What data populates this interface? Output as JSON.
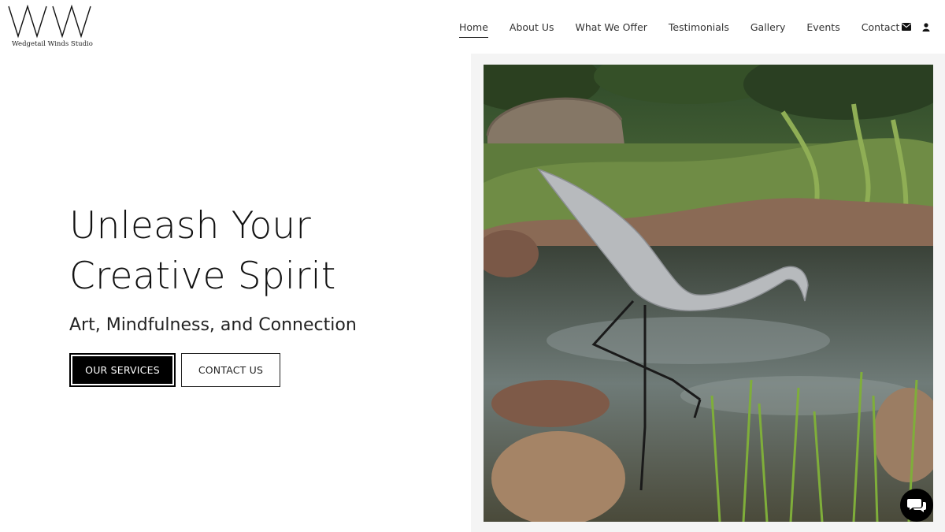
{
  "brand": {
    "logo_letters": "WW",
    "name": "Wedgetail Winds Studio"
  },
  "nav": {
    "items": [
      {
        "label": "Home",
        "active": true
      },
      {
        "label": "About Us"
      },
      {
        "label": "What We Offer"
      },
      {
        "label": "Testimonials"
      },
      {
        "label": "Gallery"
      },
      {
        "label": "Events"
      },
      {
        "label": "Contact"
      }
    ],
    "icons": [
      "envelope-icon",
      "user-icon"
    ]
  },
  "hero": {
    "title_line1": "Unleash Your",
    "title_line2": "Creative Spirit",
    "subtitle": "Art, Mindfulness, and Connection",
    "primary_button": "OUR SERVICES",
    "secondary_button": "CONTACT US"
  },
  "colors": {
    "text": "#111111",
    "button_primary_bg": "#000000",
    "panel_bg": "#f4f4f4"
  },
  "chat": {
    "icon": "chat-bubbles-icon"
  }
}
